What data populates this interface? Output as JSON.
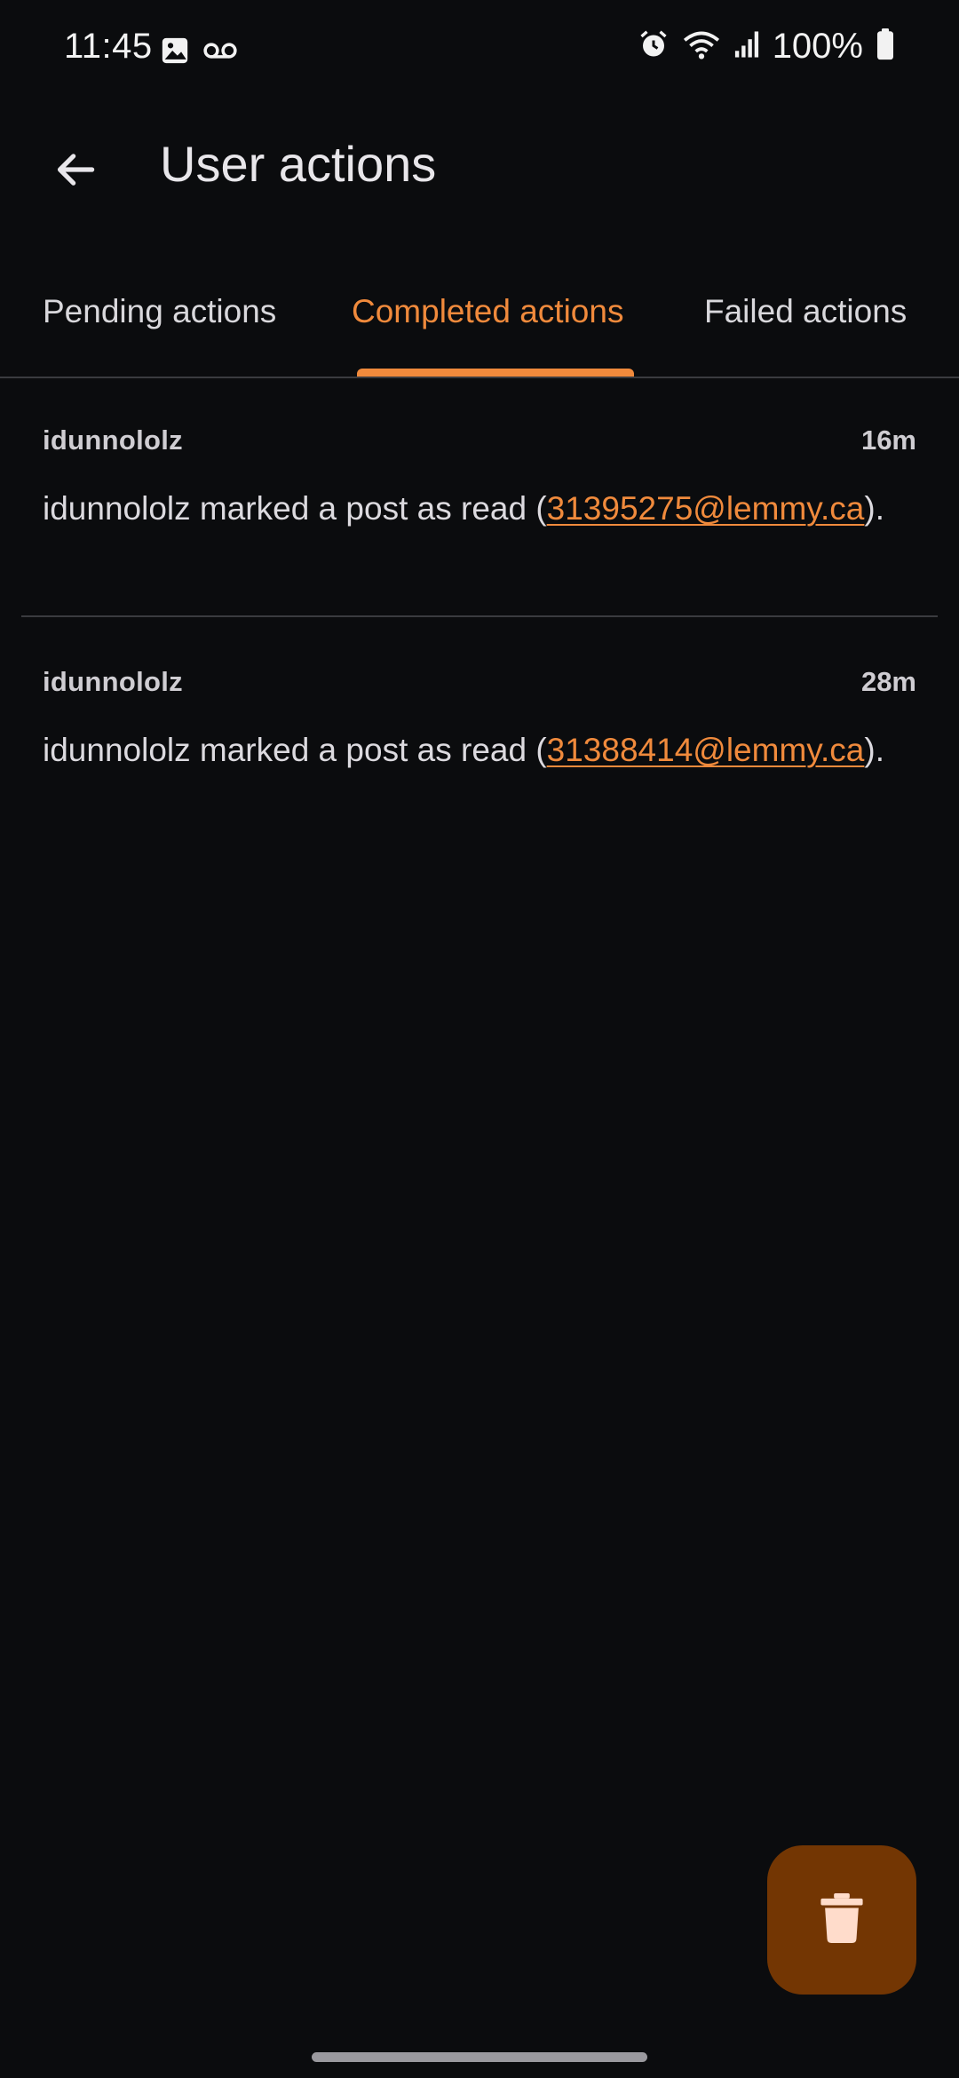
{
  "status_bar": {
    "time": "11:45",
    "battery": "100%",
    "left_icons": [
      "image-icon",
      "voicemail-icon"
    ],
    "right_icons": [
      "alarm-icon",
      "wifi-icon",
      "signal-icon",
      "battery-icon"
    ]
  },
  "app_bar": {
    "title": "User actions",
    "back_icon": "arrow-back-icon"
  },
  "tabs": [
    {
      "label": "Pending actions",
      "active": false
    },
    {
      "label": "Completed actions",
      "active": true
    },
    {
      "label": "Failed actions",
      "active": false
    }
  ],
  "actions": [
    {
      "user": "idunnololz",
      "time": "16m",
      "text_before": "idunnololz marked a post as read (",
      "link_text": "31395275@lemmy.ca",
      "text_after": ")."
    },
    {
      "user": "idunnololz",
      "time": "28m",
      "text_before": "idunnololz marked a post as read (",
      "link_text": "31388414@lemmy.ca",
      "text_after": ")."
    }
  ],
  "fab": {
    "icon": "delete-icon"
  },
  "colors": {
    "background": "#0b0c0e",
    "accent": "#f08a3c",
    "fab_background": "#733603",
    "fab_icon": "#ffdccb"
  }
}
